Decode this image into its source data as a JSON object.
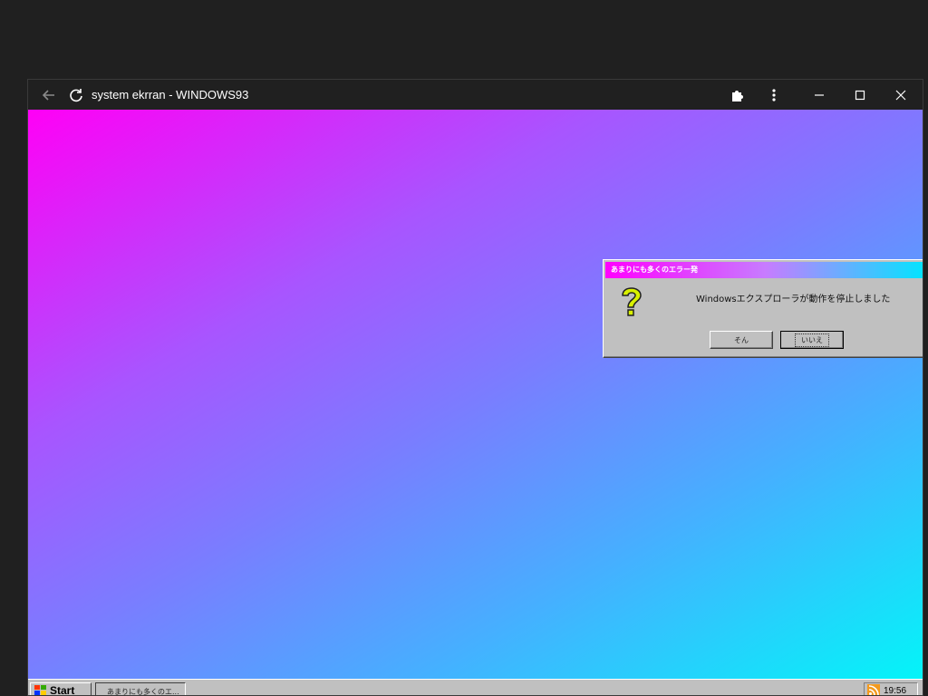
{
  "window": {
    "title": "system ekrran - WINDOWS93"
  },
  "dialog": {
    "title": "あまりにも多くのエラー発",
    "message": "Windowsエクスプローラが動作を停止しました",
    "yes_label": "そん",
    "no_label": "いいえ",
    "icon": "question-mark-icon"
  },
  "taskbar": {
    "start_label": "Start",
    "task_label": "あまりにも多くのエ...",
    "clock": "19:56"
  },
  "colors": {
    "gradient_start": "#ff00f6",
    "gradient_end": "#00f8f8",
    "dialog_bg": "#c0c0c0"
  }
}
